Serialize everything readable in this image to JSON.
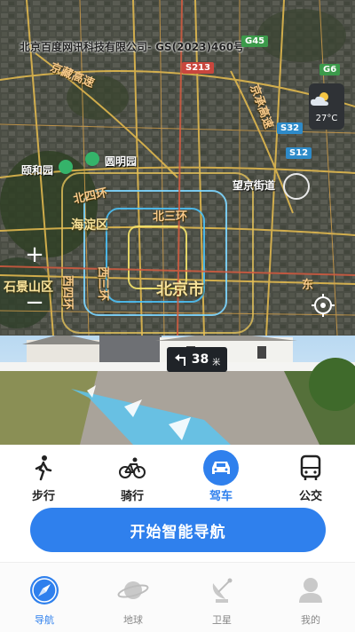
{
  "map": {
    "copyright": "北京百度网讯科技有限公司- GS(2023)460号",
    "districts": [
      "海淀区",
      "石景山区",
      "北京市"
    ],
    "roads": [
      "北四环",
      "北三环",
      "西三环",
      "西四环",
      "京承高速",
      "京藏高速",
      "东"
    ],
    "pois": [
      "颐和园",
      "圆明园",
      "望京街道"
    ],
    "shields": [
      "S213",
      "S32",
      "S12",
      "G6",
      "G45"
    ],
    "weather": {
      "temp": "27°C",
      "icon": "cloud-sun-icon"
    },
    "zoom_in": "+",
    "zoom_out": "−"
  },
  "street_view": {
    "turn_distance": "38",
    "turn_unit": "米",
    "turn_icon": "turn-left-arrow-icon"
  },
  "modes": [
    {
      "label": "步行",
      "icon": "walking-icon",
      "active": false
    },
    {
      "label": "骑行",
      "icon": "bicycle-icon",
      "active": false
    },
    {
      "label": "驾车",
      "icon": "car-icon",
      "active": true
    },
    {
      "label": "公交",
      "icon": "bus-icon",
      "active": false
    }
  ],
  "start_button": "开始智能导航",
  "tabs": [
    {
      "label": "导航",
      "icon": "compass-icon",
      "active": true
    },
    {
      "label": "地球",
      "icon": "planet-icon",
      "active": false
    },
    {
      "label": "卫星",
      "icon": "satellite-dish-icon",
      "active": false
    },
    {
      "label": "我的",
      "icon": "user-icon",
      "active": false
    }
  ],
  "colors": {
    "accent": "#2f80ed",
    "map_label": "#f7e29a",
    "route": "#5dc6f0"
  }
}
